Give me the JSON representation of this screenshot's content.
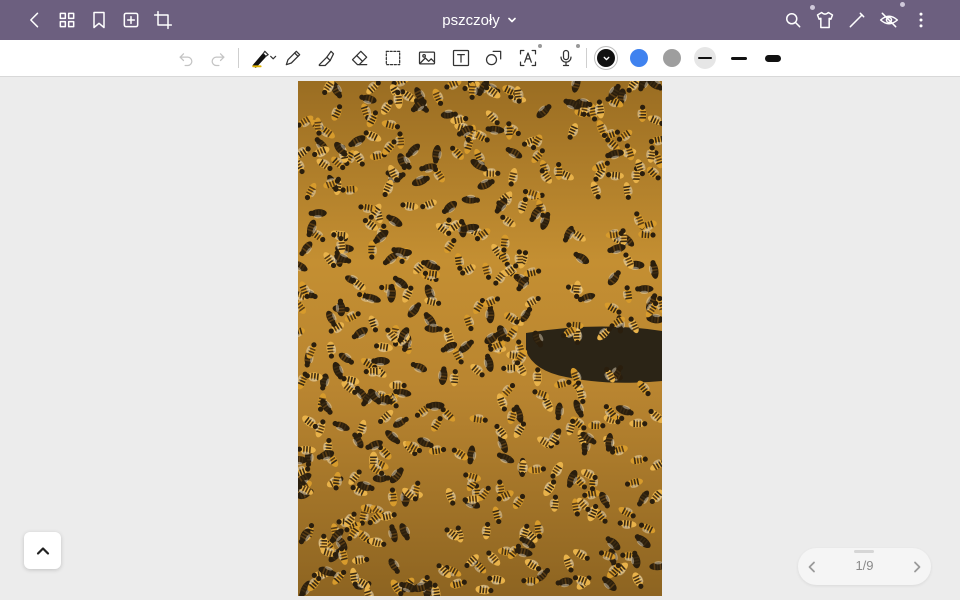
{
  "document": {
    "title": "pszczoły"
  },
  "topbar": {
    "left_icons": [
      "back-icon",
      "grid-icon",
      "bookmark-icon",
      "add-page-icon",
      "crop-icon"
    ],
    "right_icons": [
      "search-icon",
      "shirt-icon",
      "pen-icon",
      "eye-off-icon",
      "more-icon"
    ]
  },
  "toolbar": {
    "tools": [
      "undo-icon",
      "redo-icon",
      "pen-icon",
      "pencil-icon",
      "highlighter-icon",
      "eraser-icon",
      "lasso-select-icon",
      "image-icon",
      "text-icon",
      "shape-icon",
      "text-recognition-icon",
      "microphone-icon"
    ],
    "colors": {
      "black": "#111111",
      "blue": "#3f82ef",
      "gray": "#9e9e9e"
    },
    "stroke_widths": [
      "thin",
      "medium",
      "thick"
    ]
  },
  "colors": {
    "topbar": "#6c5f7f",
    "canvas": "#ececec"
  },
  "pager": {
    "label": "1/9"
  }
}
